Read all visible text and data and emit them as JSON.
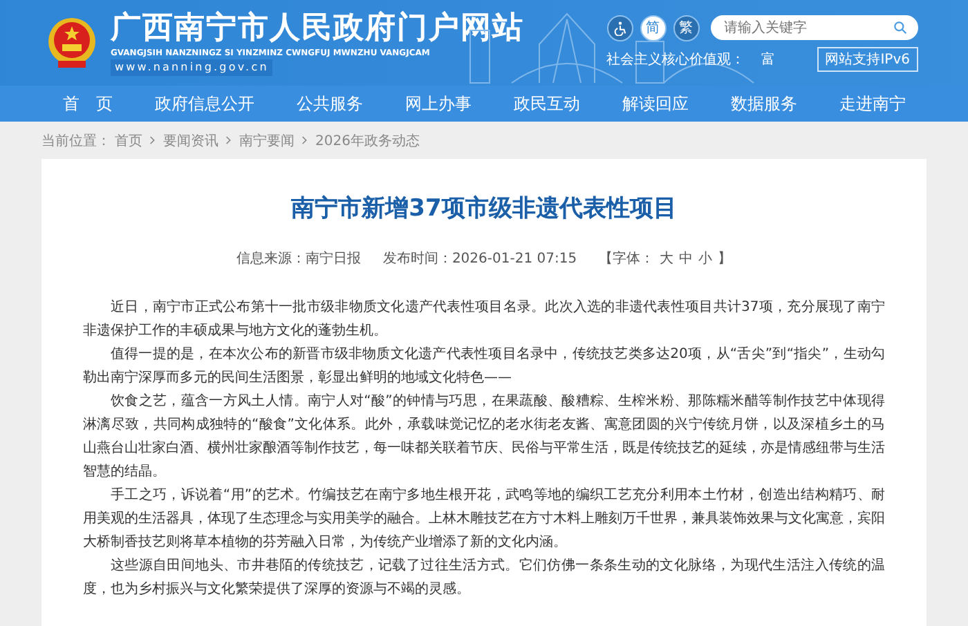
{
  "header": {
    "site_title": "广西南宁市人民政府门户网站",
    "subtitle": "GVANGJSIH NANZNINGZ SI YINZMINZ CWNGFUJ MWNZHU VANGJCAM",
    "url": "www.nanning.gov.cn",
    "script_toggles": [
      {
        "label": "简",
        "selected": true
      },
      {
        "label": "繁",
        "selected": false
      }
    ],
    "search": {
      "placeholder": "请输入关键字"
    },
    "values_label": "社会主义核心价值观：",
    "values_word": "富",
    "ipv6": "网站支持IPv6"
  },
  "nav": [
    "首　页",
    "政府信息公开",
    "公共服务",
    "网上办事",
    "政民互动",
    "解读回应",
    "数据服务",
    "走进南宁"
  ],
  "breadcrumb": {
    "label": "当前位置：",
    "items": [
      "首页",
      "要闻资讯",
      "南宁要闻",
      "2026年政务动态"
    ]
  },
  "article": {
    "title": "南宁市新增37项市级非遗代表性项目",
    "source": "信息来源：南宁日报",
    "time": "发布时间：2026-01-21 07:15",
    "font_label": "【字体：",
    "font_sizes": [
      "大",
      "中",
      "小"
    ],
    "font_end": "】",
    "paragraphs": [
      "近日，南宁市正式公布第十一批市级非物质文化遗产代表性项目名录。此次入选的非遗代表性项目共计37项，充分展现了南宁非遗保护工作的丰硕成果与地方文化的蓬勃生机。",
      "值得一提的是，在本次公布的新晋市级非物质文化遗产代表性项目名录中，传统技艺类多达20项，从“舌尖”到“指尖”，生动勾勒出南宁深厚而多元的民间生活图景，彰显出鲜明的地域文化特色——",
      "饮食之艺，蕴含一方风土人情。南宁人对“酸”的钟情与巧思，在果蔬酸、酸糟粽、生榨米粉、那陈糯米醋等制作技艺中体现得淋漓尽致，共同构成独特的“酸食”文化体系。此外，承载味觉记忆的老水街老友酱、寓意团圆的兴宁传统月饼，以及深植乡土的马山燕台山壮家白酒、横州壮家酿酒等制作技艺，每一味都关联着节庆、民俗与平常生活，既是传统技艺的延续，亦是情感纽带与生活智慧的结晶。",
      "手工之巧，诉说着“用”的艺术。竹编技艺在南宁多地生根开花，武鸣等地的编织工艺充分利用本土竹材，创造出结构精巧、耐用美观的生活器具，体现了生态理念与实用美学的融合。上林木雕技艺在方寸木料上雕刻万千世界，兼具装饰效果与文化寓意，宾阳大桥制香技艺则将草本植物的芬芳融入日常，为传统产业增添了新的文化内涵。",
      "这些源自田间地头、市井巷陌的传统技艺，记载了过往生活方式。它们仿佛一条条生动的文化脉络，为现代生活注入传统的温度，也为乡村振兴与文化繁荣提供了深厚的资源与不竭的灵感。"
    ]
  }
}
